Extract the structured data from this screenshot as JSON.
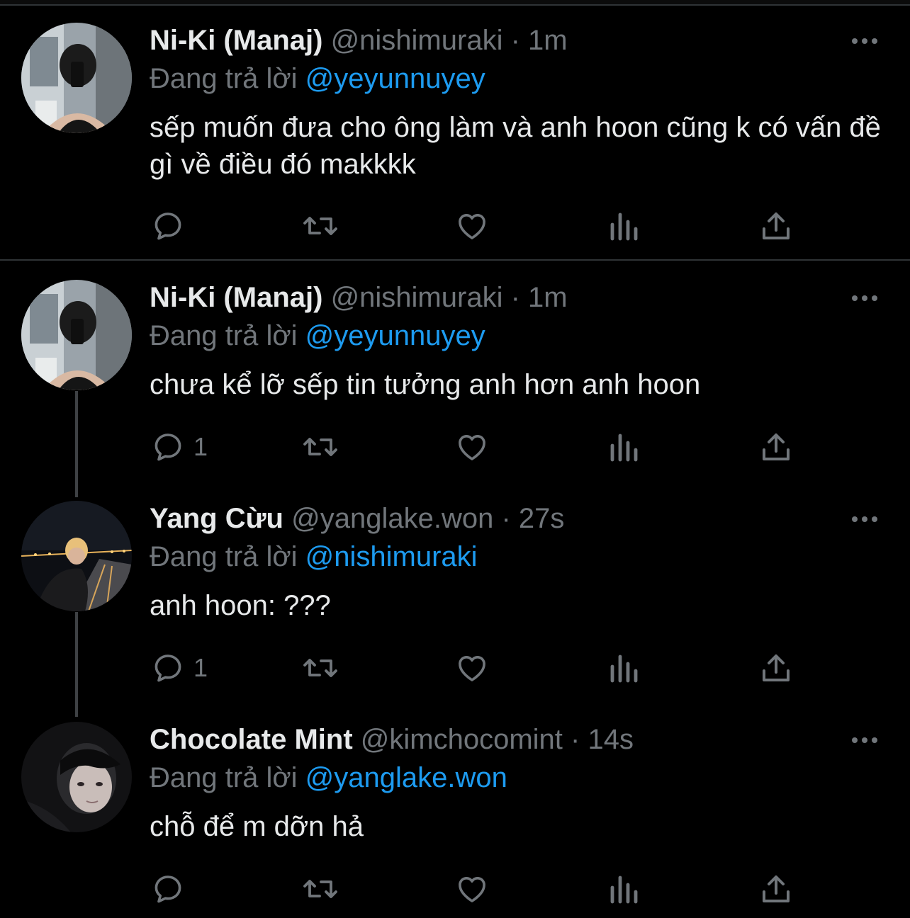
{
  "colors": {
    "background": "#000000",
    "text": "#e7e9ea",
    "muted": "#71767b",
    "link": "#1d9bf0",
    "divider": "#2f3336"
  },
  "tweets": [
    {
      "name": "Ni-Ki (Manaj)",
      "handle": "@nishimuraki",
      "time": "· 1m",
      "reply_prefix": "Đang trả lời",
      "reply_to": "@yeyunnuyey",
      "text": "sếp muốn đưa cho ông làm và anh hoon cũng k có vấn đề gì về điều đó makkkk",
      "reply_count": "",
      "avatar": "mirror-selfie-avatar"
    },
    {
      "name": "Ni-Ki (Manaj)",
      "handle": "@nishimuraki",
      "time": "· 1m",
      "reply_prefix": "Đang trả lời",
      "reply_to": "@yeyunnuyey",
      "text": "chưa kể lỡ sếp tin tưởng anh hơn anh hoon",
      "reply_count": "1",
      "avatar": "mirror-selfie-avatar"
    },
    {
      "name": "Yang Cừu",
      "handle": "@yanglake.won",
      "time": "· 27s",
      "reply_prefix": "Đang trả lời",
      "reply_to": "@nishimuraki",
      "text": "anh hoon: ???",
      "reply_count": "1",
      "avatar": "night-highway-avatar"
    },
    {
      "name": "Chocolate Mint",
      "handle": "@kimchocomint",
      "time": "· 14s",
      "reply_prefix": "Đang trả lời",
      "reply_to": "@yanglake.won",
      "text": "chỗ để m dỡn hả",
      "reply_count": "",
      "avatar": "dark-portrait-avatar"
    }
  ],
  "icons": [
    "reply-icon",
    "retweet-icon",
    "like-icon",
    "views-icon",
    "share-icon",
    "more-icon"
  ]
}
